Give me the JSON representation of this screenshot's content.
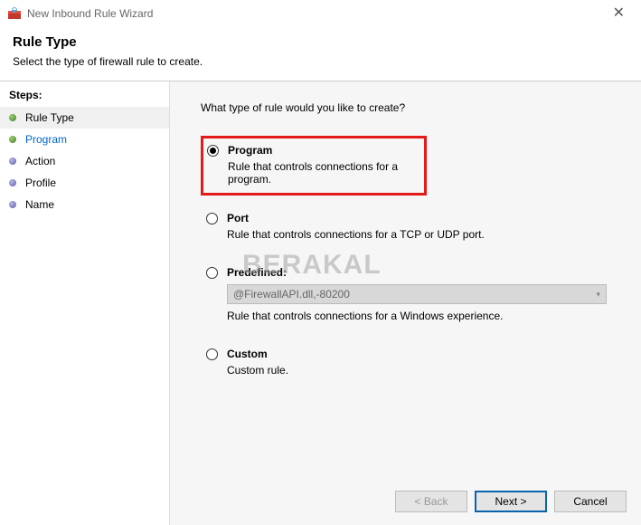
{
  "window": {
    "title": "New Inbound Rule Wizard"
  },
  "header": {
    "title": "Rule Type",
    "subtitle": "Select the type of firewall rule to create."
  },
  "sidebar": {
    "heading": "Steps:",
    "steps": [
      {
        "label": "Rule Type"
      },
      {
        "label": "Program"
      },
      {
        "label": "Action"
      },
      {
        "label": "Profile"
      },
      {
        "label": "Name"
      }
    ]
  },
  "content": {
    "prompt": "What type of rule would you like to create?",
    "options": [
      {
        "label": "Program",
        "desc": "Rule that controls connections for a program.",
        "selected": true,
        "highlight": true
      },
      {
        "label": "Port",
        "desc": "Rule that controls connections for a TCP or UDP port."
      },
      {
        "label": "Predefined:",
        "dropdown_value": "@FirewallAPI.dll,-80200",
        "desc": "Rule that controls connections for a Windows experience."
      },
      {
        "label": "Custom",
        "desc": "Custom rule."
      }
    ]
  },
  "buttons": {
    "back": "< Back",
    "next": "Next >",
    "cancel": "Cancel"
  },
  "watermark": "BERAKAL"
}
